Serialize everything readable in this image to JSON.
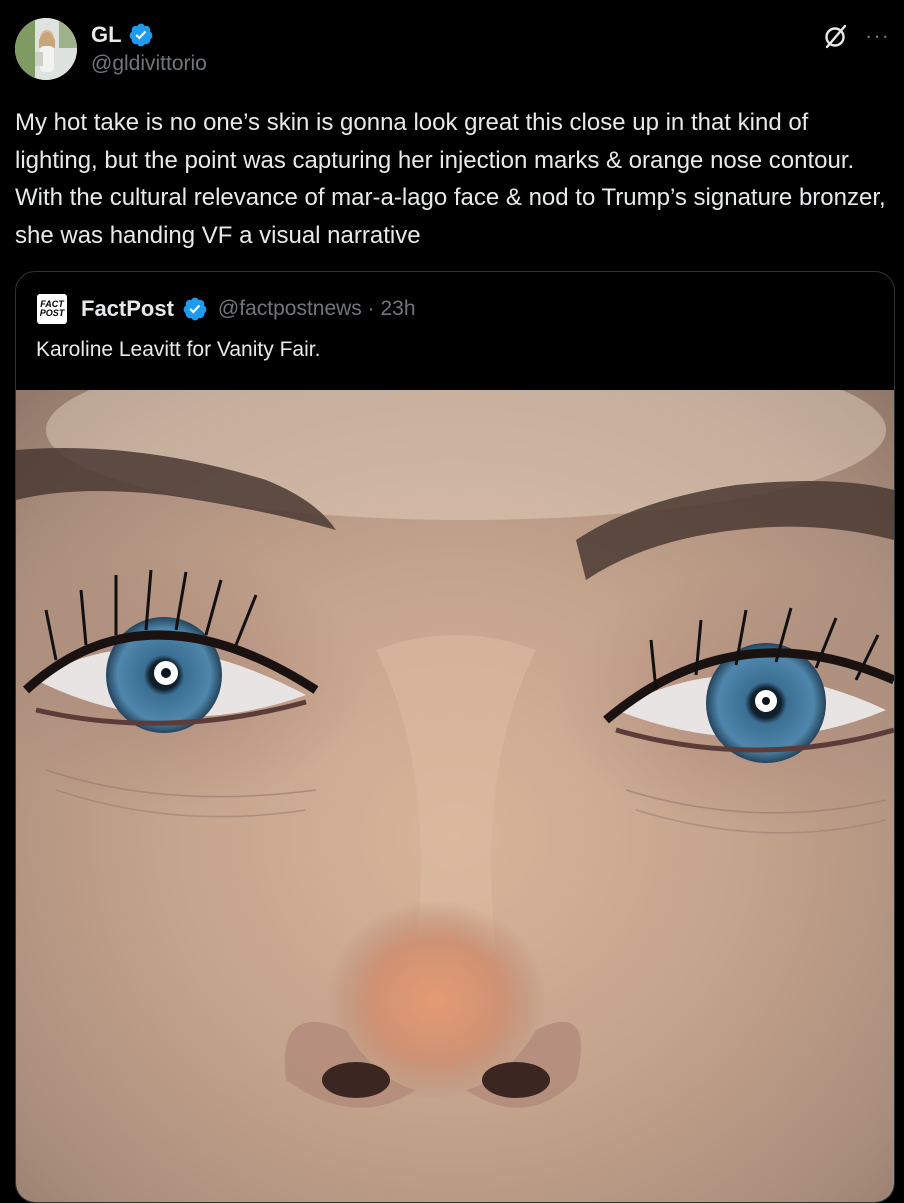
{
  "author": {
    "display_name": "GL",
    "handle": "@gldivittorio",
    "verified": true
  },
  "post": {
    "text": "My hot take is no one’s skin is gonna look great this close up in that kind of lighting, but the point was capturing her injection marks & orange nose contour. With the cultural relevance of mar-a-lago face & nod to Trump’s signature bronzer, she was handing VF a visual narrative"
  },
  "top_actions": {
    "grok_icon": "grok-slash-icon",
    "more_label": "···"
  },
  "quote": {
    "logo_line1": "FACT",
    "logo_line2": "POST",
    "display_name": "FactPost",
    "verified": true,
    "handle_time": "@factpostnews · 23h",
    "text": "Karoline Leavitt for Vanity Fair.",
    "media_icon": "close-up-face-photo"
  },
  "colors": {
    "background": "#000000",
    "text_primary": "#e7e9ea",
    "text_secondary": "#71767b",
    "verified_blue": "#1d9bf0",
    "border": "#2f3336"
  }
}
